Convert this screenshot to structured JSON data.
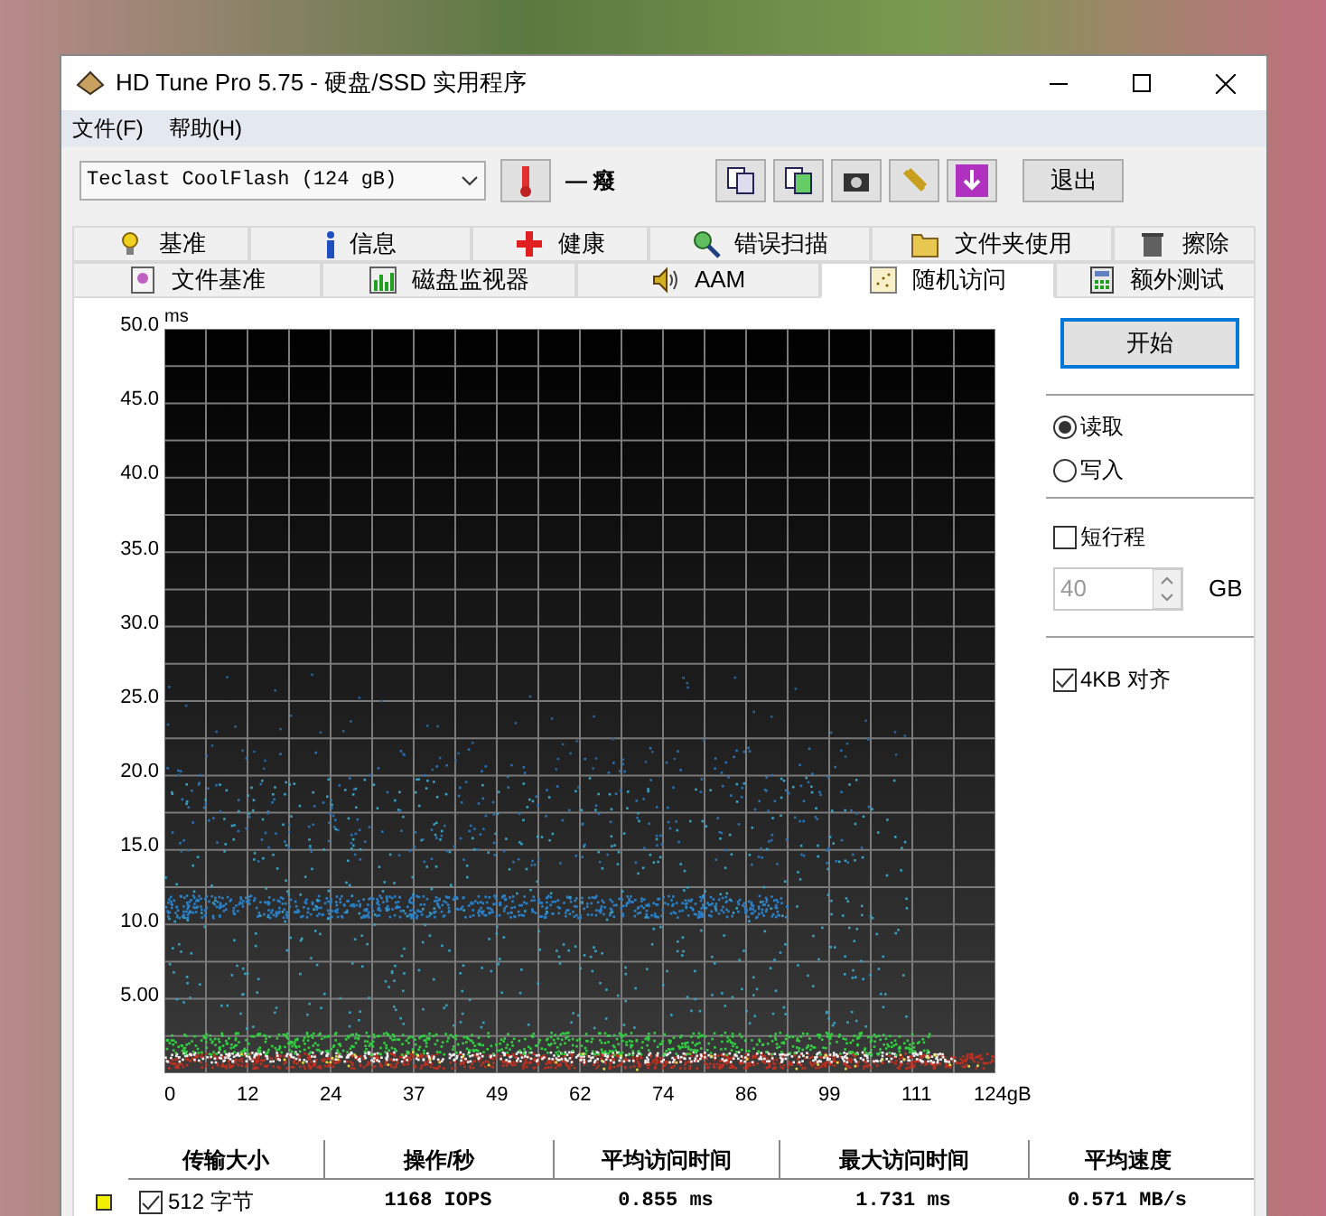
{
  "window": {
    "title": "HD Tune Pro 5.75 - 硬盘/SSD 实用程序"
  },
  "menu": [
    "文件(F)",
    "帮助(H)"
  ],
  "toolbar": {
    "drive": "Teclast CoolFlash (124 gB)",
    "temperature": "— 癈",
    "exit_button": "退出"
  },
  "tabs_row1": [
    {
      "label": "基准",
      "selected": false
    },
    {
      "label": "信息",
      "selected": false
    },
    {
      "label": "健康",
      "selected": false
    },
    {
      "label": "错误扫描",
      "selected": false
    },
    {
      "label": "文件夹使用",
      "selected": false
    },
    {
      "label": "擦除",
      "selected": false
    }
  ],
  "tabs_row2": [
    {
      "label": "文件基准",
      "selected": false
    },
    {
      "label": "磁盘监视器",
      "selected": false
    },
    {
      "label": "AAM",
      "selected": false
    },
    {
      "label": "随机访问",
      "selected": true
    },
    {
      "label": "额外测试",
      "selected": false
    }
  ],
  "plot": {
    "y_unit": "ms",
    "y_ticks": [
      "50.0",
      "45.0",
      "40.0",
      "35.0",
      "30.0",
      "25.0",
      "20.0",
      "15.0",
      "10.0",
      "5.00"
    ],
    "x_ticks": [
      "0",
      "12",
      "24",
      "37",
      "49",
      "62",
      "74",
      "86",
      "99",
      "111",
      "124gB"
    ]
  },
  "side": {
    "start_button": "开始",
    "modes": [
      {
        "label": "读取",
        "selected": true
      },
      {
        "label": "写入",
        "selected": false
      }
    ],
    "short_stroke": {
      "label": "短行程",
      "checked": false
    },
    "stroke_value": "40",
    "stroke_unit": "GB",
    "align": {
      "label": "4KB 对齐",
      "checked": true
    }
  },
  "table": {
    "columns": [
      "传输大小",
      "操作/秒",
      "平均访问时间",
      "最大访问时间",
      "平均速度"
    ],
    "rows": [
      {
        "color": "#f0f000",
        "checked": true,
        "size": "512 字节",
        "ops": "1168 IOPS",
        "avg": "0.855 ms",
        "max": "1.731 ms",
        "speed": "0.571 MB/s"
      }
    ]
  }
}
